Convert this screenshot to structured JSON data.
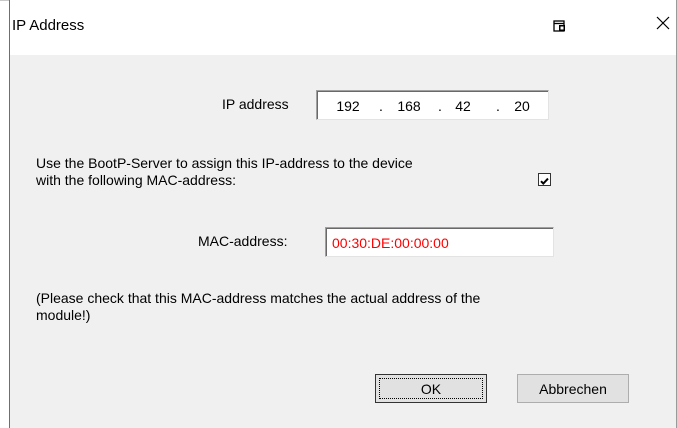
{
  "window": {
    "title": "IP Address"
  },
  "ip": {
    "label": "IP address",
    "octets": [
      "192",
      "168",
      "42",
      "20"
    ],
    "separator": "."
  },
  "bootp": {
    "line1": "Use the BootP-Server to assign this IP-address to the device",
    "line2": "with the following MAC-address:",
    "checked": true
  },
  "mac": {
    "label": "MAC-address:",
    "value": "00:30:DE:00:00:00",
    "value_color": "#ff0000"
  },
  "note": {
    "line1": "(Please check that this MAC-address matches the actual address of the",
    "line2": "module!)"
  },
  "buttons": {
    "ok_label": "OK",
    "cancel_label": "Abbrechen"
  },
  "icons": {
    "title_icon": "pin-window-icon",
    "close_icon": "close-icon",
    "checkbox_mark": "checkmark-icon"
  }
}
